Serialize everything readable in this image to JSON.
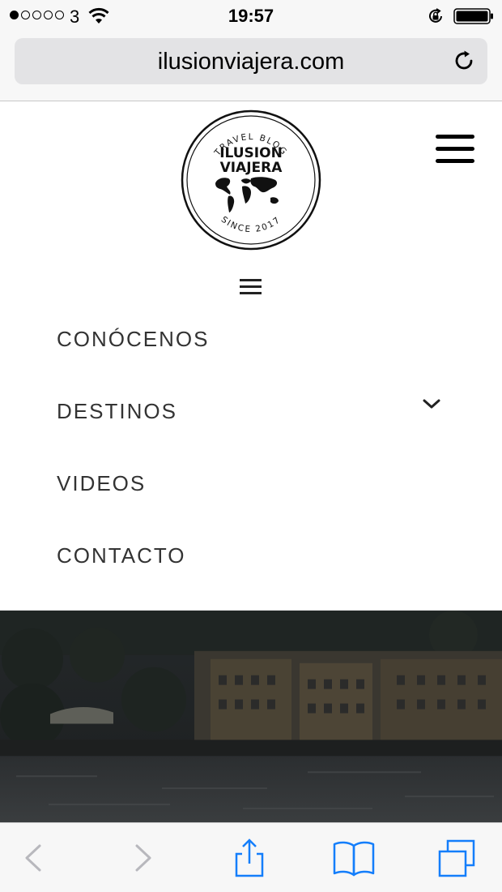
{
  "status_bar": {
    "carrier": "3",
    "time": "19:57",
    "signal_bars_filled": 1,
    "signal_bars_total": 5,
    "icons": [
      "wifi-icon",
      "rotation-lock-icon",
      "battery-icon"
    ]
  },
  "browser": {
    "url": "ilusionviajera.com",
    "icons": [
      "reload-icon"
    ]
  },
  "site": {
    "logo": {
      "top_text": "TRAVEL BLOG",
      "name_line1": "ILUSION",
      "name_line2": "VIAJERA",
      "bottom_text": "SINCE 2017"
    },
    "icons": [
      "hamburger-menu-icon",
      "small-hamburger-icon"
    ]
  },
  "menu": {
    "items": [
      {
        "label": "CONÓCENOS",
        "has_submenu": false
      },
      {
        "label": "DESTINOS",
        "has_submenu": true
      },
      {
        "label": "VIDEOS",
        "has_submenu": false
      },
      {
        "label": "CONTACTO",
        "has_submenu": false
      }
    ]
  },
  "toolbar": {
    "icons": [
      "back-icon",
      "forward-icon",
      "share-icon",
      "bookmarks-icon",
      "tabs-icon"
    ]
  },
  "colors": {
    "ios_blue": "#147efb",
    "disabled_gray": "#b8b8bd",
    "menu_text": "#333333",
    "bar_bg": "#f7f7f7"
  }
}
